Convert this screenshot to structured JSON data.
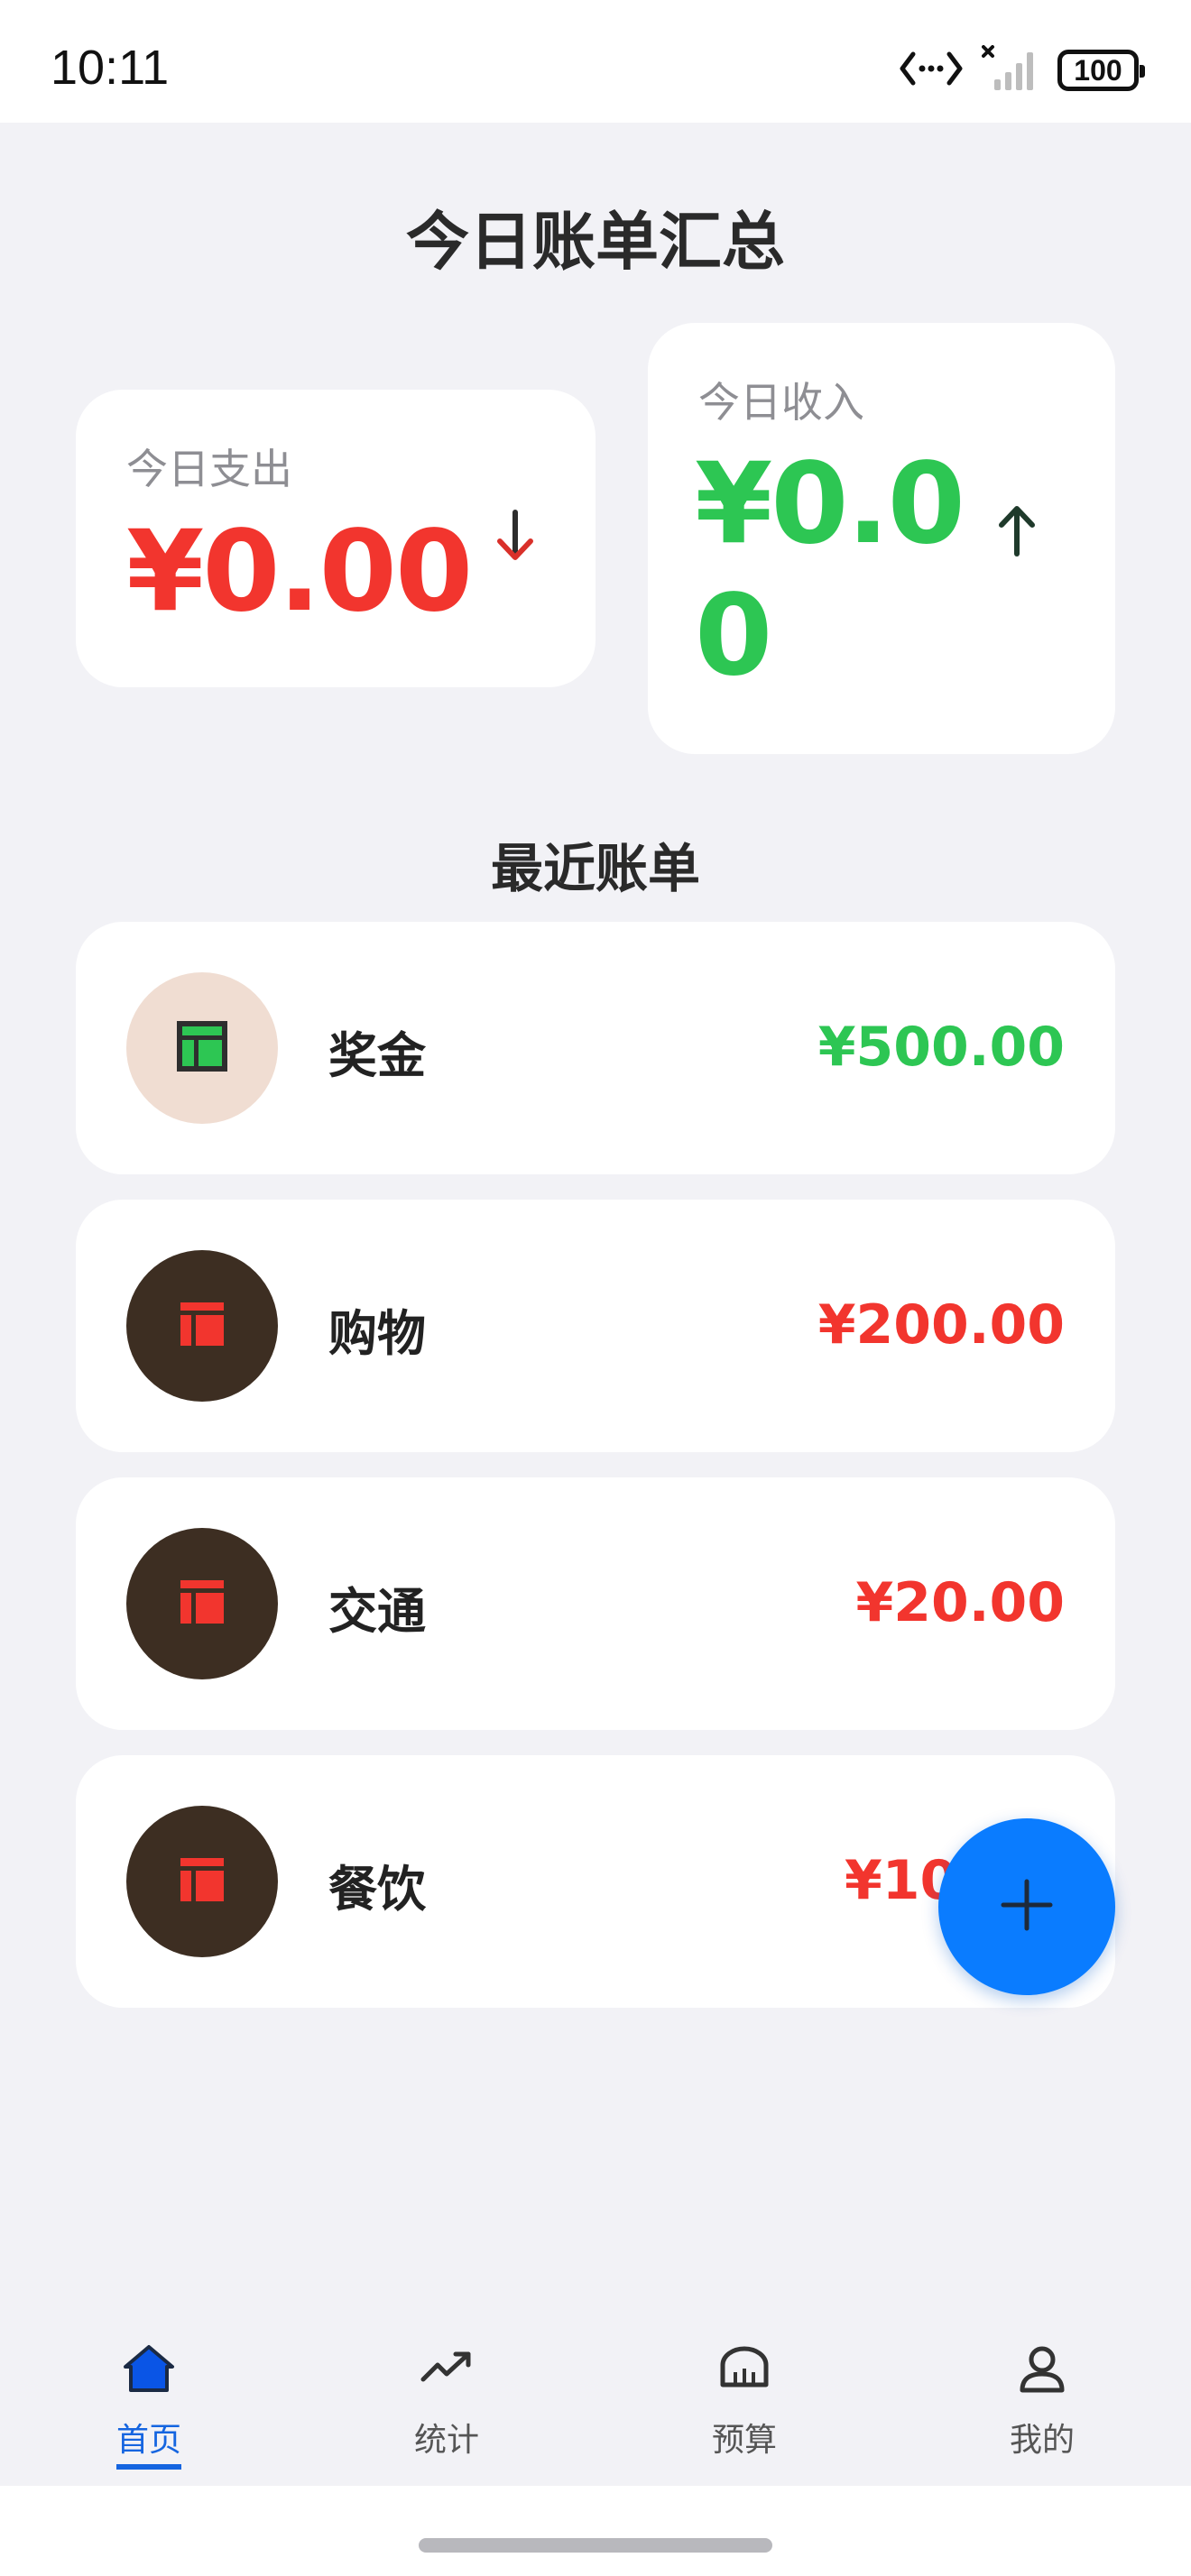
{
  "status_bar": {
    "time": "10:11",
    "battery": "100"
  },
  "title": "今日账单汇总",
  "summary": {
    "expense": {
      "label": "今日支出",
      "amount": "¥0.00"
    },
    "income": {
      "label": "今日收入",
      "amount": "¥0.00"
    }
  },
  "recent": {
    "title": "最近账单",
    "items": [
      {
        "name": "奖金",
        "amount": "¥500.00",
        "type": "income",
        "icon": "table-icon"
      },
      {
        "name": "购物",
        "amount": "¥200.00",
        "type": "expense",
        "icon": "table-icon"
      },
      {
        "name": "交通",
        "amount": "¥20.00",
        "type": "expense",
        "icon": "table-icon"
      },
      {
        "name": "餐饮",
        "amount": "¥10",
        "type": "expense",
        "icon": "table-icon"
      }
    ]
  },
  "fab": {
    "icon": "plus-icon"
  },
  "nav": {
    "items": [
      {
        "label": "首页",
        "icon": "home-icon",
        "active": true
      },
      {
        "label": "统计",
        "icon": "trend-icon",
        "active": false
      },
      {
        "label": "预算",
        "icon": "budget-icon",
        "active": false
      },
      {
        "label": "我的",
        "icon": "user-icon",
        "active": false
      }
    ]
  },
  "colors": {
    "expense": "#f2352e",
    "income": "#2dc653",
    "accent": "#0a7cff",
    "nav_active": "#1565e0",
    "background": "#f2f2f6"
  }
}
